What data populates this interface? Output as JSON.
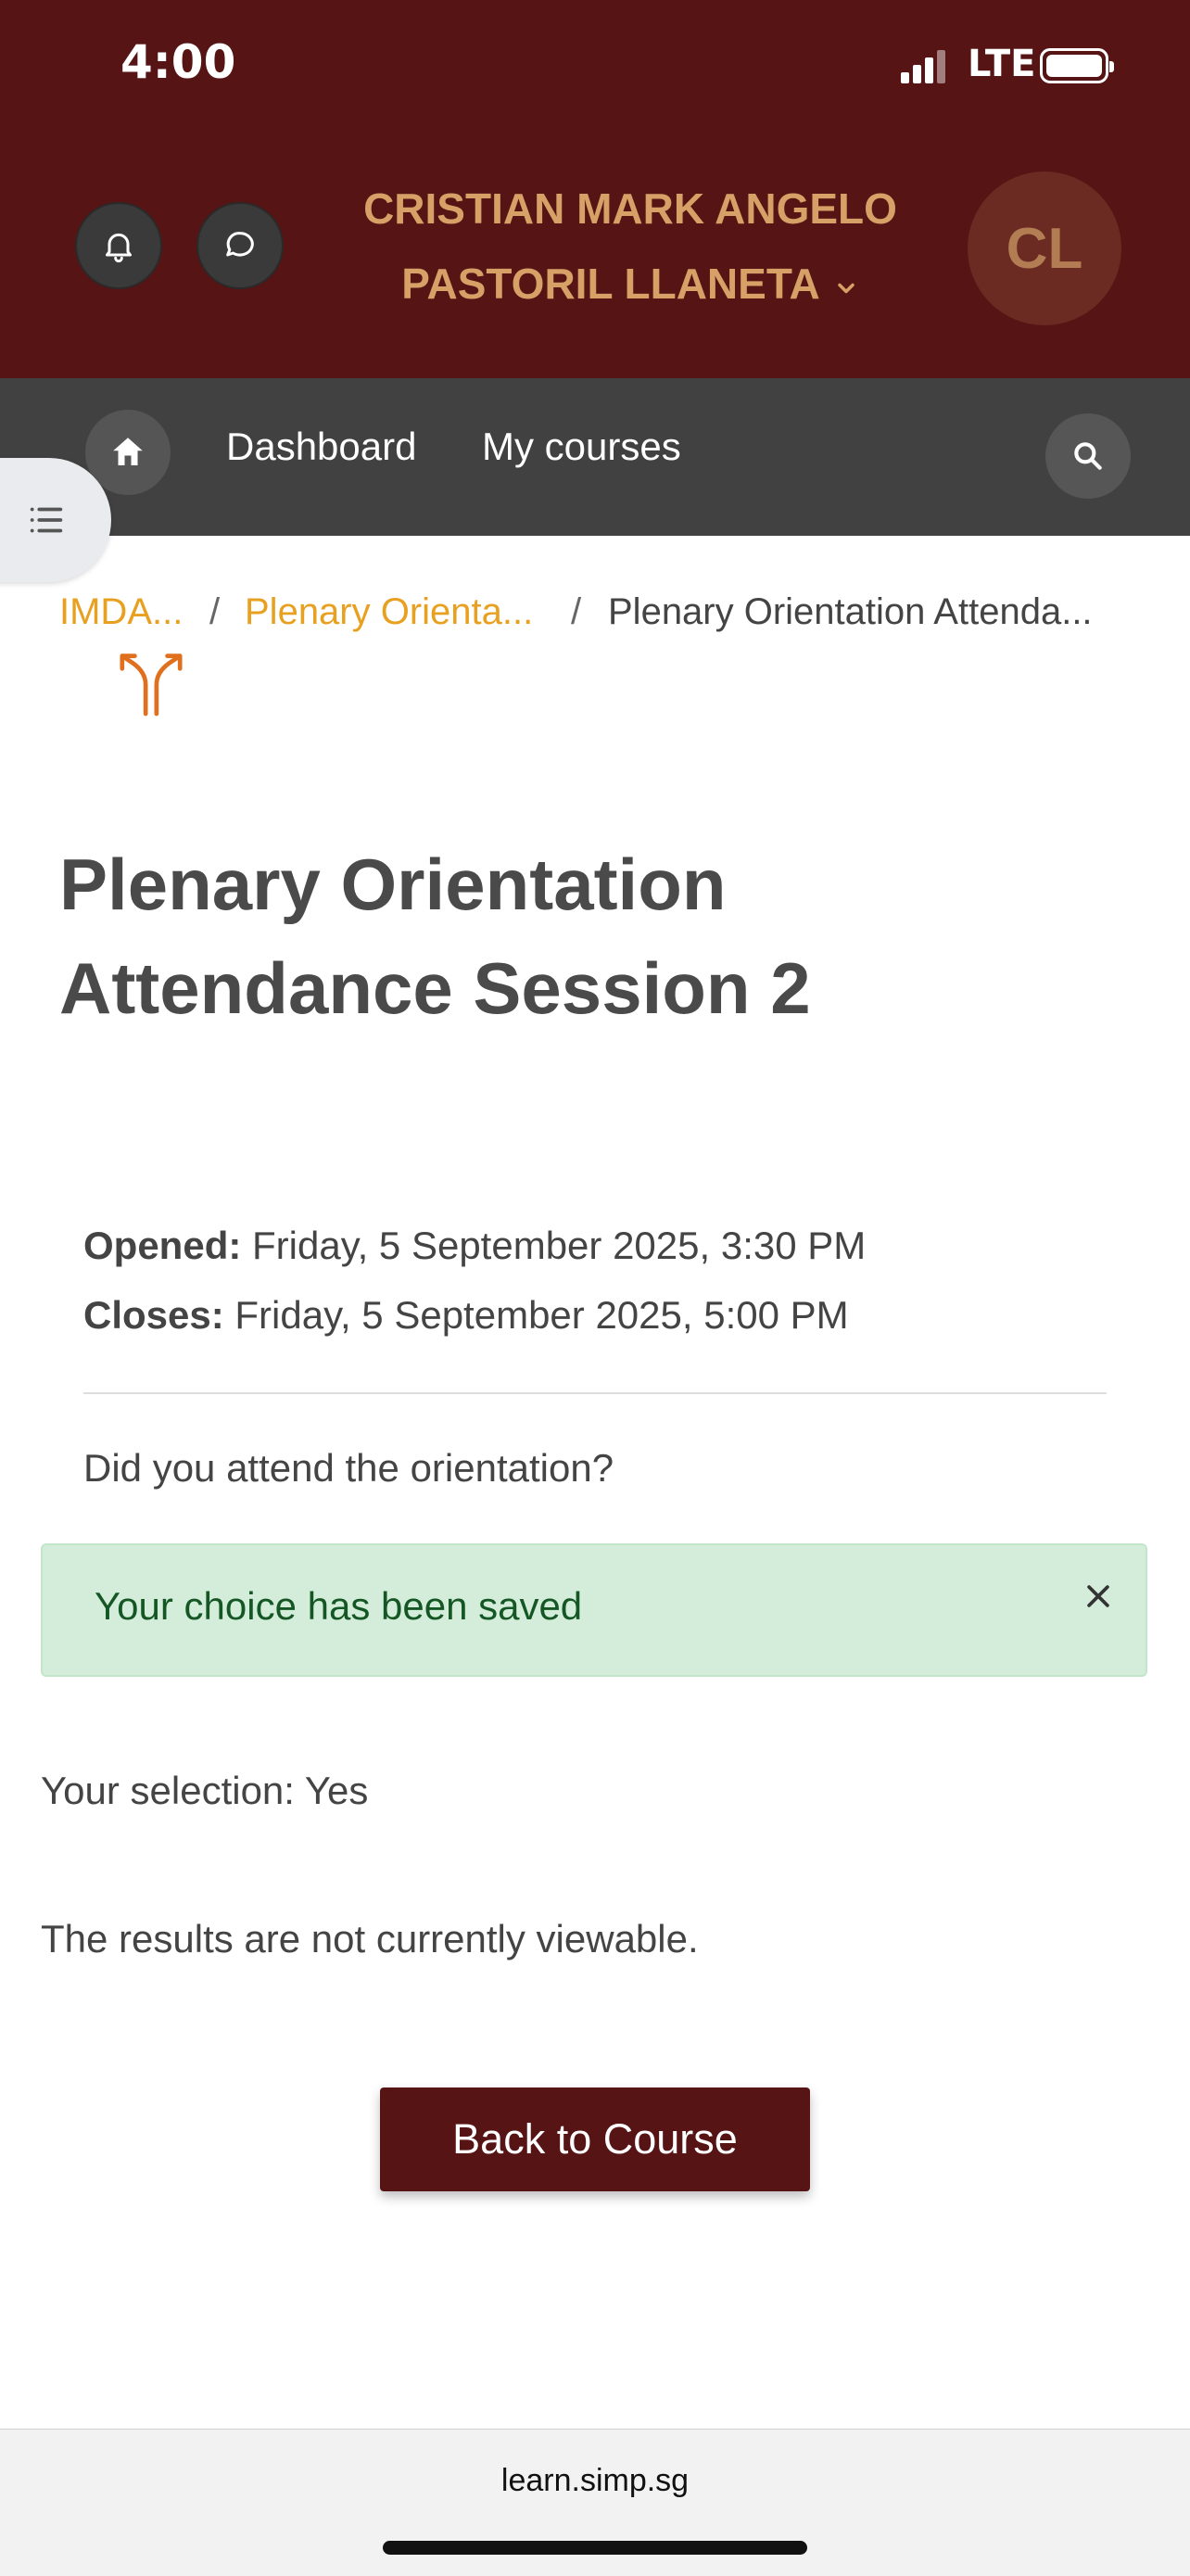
{
  "status_bar": {
    "time": "4:00",
    "network": "LTE"
  },
  "header": {
    "user_name_line1": "CRISTIAN MARK ANGELO",
    "user_name_line2": "PASTORIL LLANETA",
    "avatar_initials": "CL",
    "icons": [
      "bell-icon",
      "chat-icon",
      "chevron-down-icon"
    ]
  },
  "nav": {
    "links": [
      "Dashboard",
      "My courses"
    ],
    "icons": [
      "home-icon",
      "search-icon",
      "list-icon"
    ]
  },
  "breadcrumb": {
    "items": [
      "IMDA...",
      "Plenary Orienta...",
      "Plenary Orientation Attenda..."
    ],
    "separator": "/"
  },
  "page": {
    "title": "Plenary Orientation Attendance Session 2",
    "opened_label": "Opened:",
    "opened_value": "Friday, 5 September 2025, 3:30 PM",
    "closes_label": "Closes:",
    "closes_value": "Friday, 5 September 2025, 5:00 PM",
    "question": "Did you attend the orientation?",
    "alert": "Your choice has been saved",
    "selection": "Your selection: Yes",
    "results_note": "The results are not currently viewable.",
    "back_button": "Back to Course"
  },
  "browser": {
    "url": "learn.simp.sg"
  },
  "colors": {
    "brand": "#561414",
    "nav": "#414141",
    "accent_name": "#d6a066",
    "link": "#e8a020",
    "alert_bg": "#d4edda",
    "alert_text": "#155724"
  }
}
